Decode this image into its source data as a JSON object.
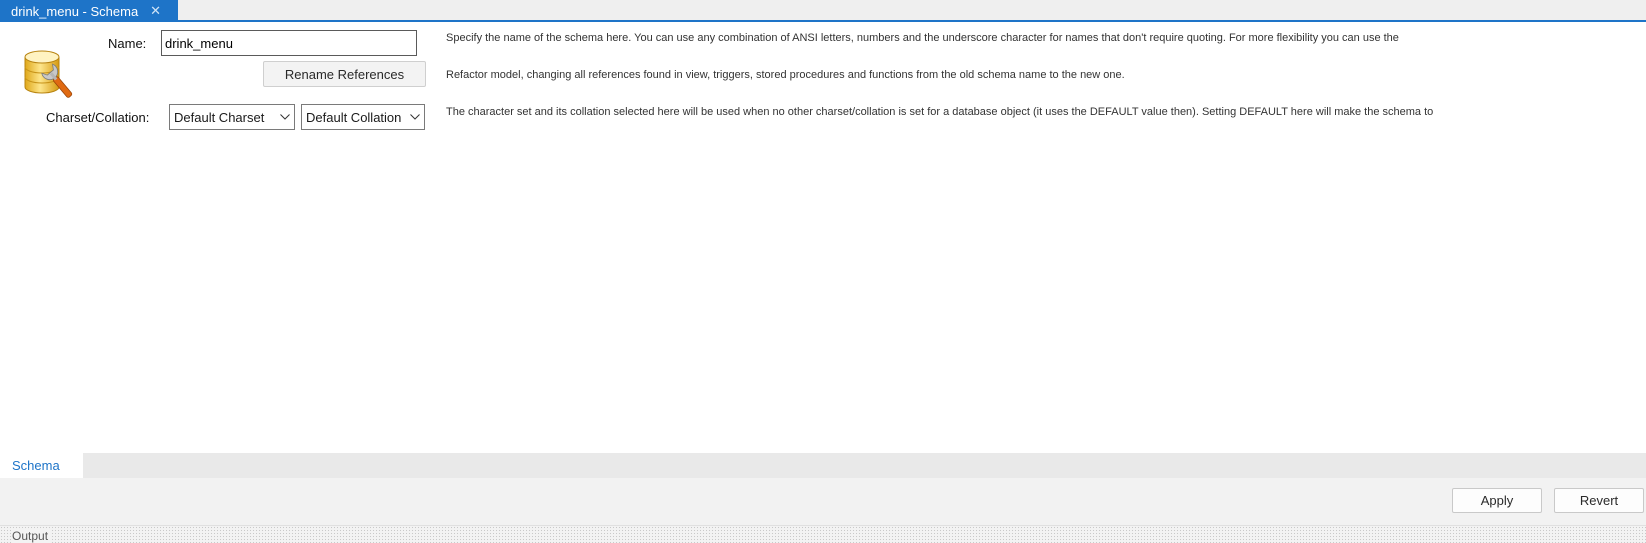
{
  "tab": {
    "title": "drink_menu - Schema",
    "close_glyph": "✕"
  },
  "form": {
    "name_label": "Name:",
    "name_value": "drink_menu",
    "rename_button": "Rename References",
    "charset_label": "Charset/Collation:",
    "charset_value": "Default Charset",
    "collation_value": "Default Collation"
  },
  "descriptions": {
    "name": "Specify the name of the schema here. You can use any combination of ANSI letters, numbers and the underscore character for names that don't require quoting. For more flexibility you can use the",
    "rename": "Refactor model, changing all references found in view, triggers, stored procedures and functions from the old schema name to the new one.",
    "charset": "The character set and its collation selected here will be used when no other charset/collation is set for a database object (it uses the DEFAULT value then). Setting DEFAULT here will make the schema to"
  },
  "bottom_tabs": [
    {
      "label": "Schema"
    }
  ],
  "actions": {
    "apply": "Apply",
    "revert": "Revert"
  },
  "output": {
    "label": "Output"
  },
  "colors": {
    "accent": "#1e74c8"
  },
  "icons": {
    "schema": "database-wrench-icon",
    "chevron": "chevron-down-icon",
    "close": "close-icon"
  }
}
